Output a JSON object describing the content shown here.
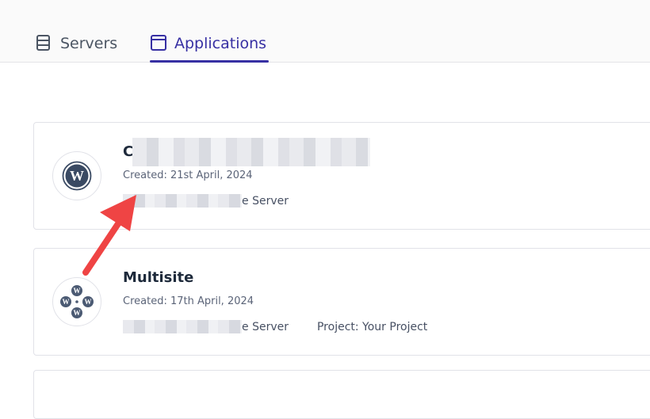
{
  "tabs": [
    {
      "label": "Servers",
      "icon": "server-icon",
      "active": false
    },
    {
      "label": "Applications",
      "icon": "window-icon",
      "active": true
    }
  ],
  "colors": {
    "accent": "#3730a3",
    "annotation_arrow": "#ef4444"
  },
  "applications": [
    {
      "name_visible_prefix": "C",
      "created": "Created: 21st April, 2024",
      "server_suffix": "e Server",
      "icon": "wordpress-icon"
    },
    {
      "name": "Multisite",
      "created": "Created: 17th April, 2024",
      "server_suffix": "e Server",
      "project": "Project: Your Project",
      "icon": "wordpress-multisite-icon"
    }
  ]
}
